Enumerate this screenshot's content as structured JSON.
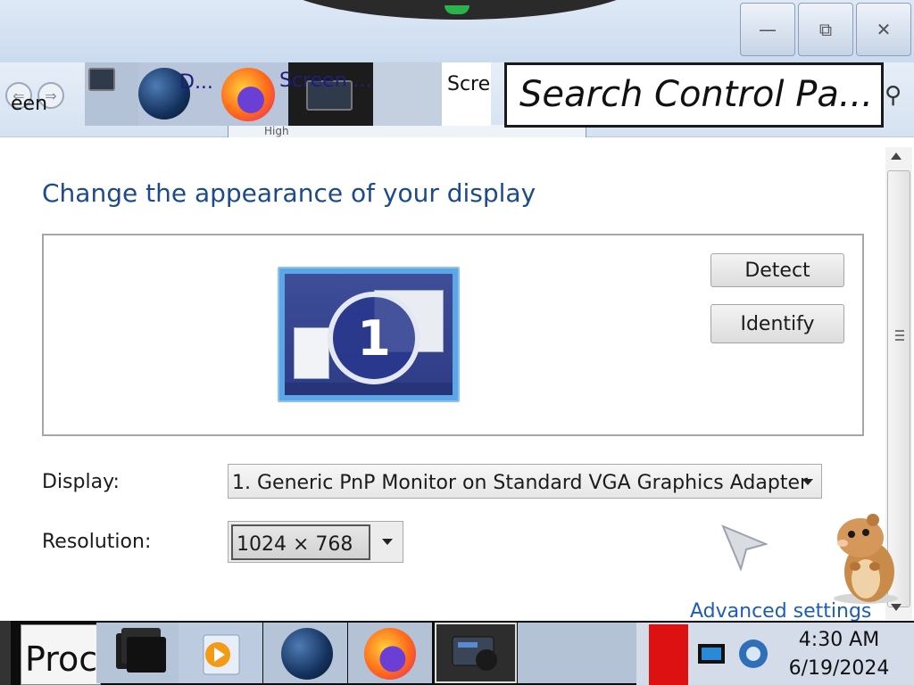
{
  "window": {
    "minimize_glyph": "—",
    "maximize_glyph": "⧉",
    "close_glyph": "✕"
  },
  "address": {
    "back_glyph": "⇐",
    "forward_glyph": "⇒",
    "crumb_fragment": "een",
    "thumbnails": [
      {
        "label": "D..."
      },
      {
        "label": "Screen ..."
      },
      {
        "label": "Scre"
      }
    ],
    "search_placeholder": "Search Control Pa...",
    "search_glyph": "⚲",
    "crumb_tab_text": "High"
  },
  "main": {
    "title": "Change the appearance of your display",
    "monitor_number": "1",
    "detect_label": "Detect",
    "identify_label": "Identify",
    "display_label": "Display:",
    "display_value": "1. Generic PnP Monitor on Standard VGA Graphics Adapter",
    "resolution_label": "Resolution:",
    "resolution_value": "1024 × 768",
    "advanced_link": "Advanced settings"
  },
  "taskbar": {
    "behind_window_text": "Proc",
    "clock_time": "4:30 AM",
    "clock_date": "6/19/2024"
  },
  "icons": [
    "minimize-icon",
    "maximize-icon",
    "close-icon",
    "back-icon",
    "forward-icon",
    "search-icon",
    "monitor-icon",
    "mouse-cursor-icon",
    "hamster-mascot",
    "files-icon",
    "media-player-icon",
    "globe-icon",
    "firefox-icon",
    "screen-app-icon",
    "flag-icon",
    "network-icon",
    "volume-icon"
  ],
  "colors": {
    "title_blue": "#1c4a8a",
    "link_blue": "#1e5db5",
    "taskbar": "#0d0d0d"
  }
}
